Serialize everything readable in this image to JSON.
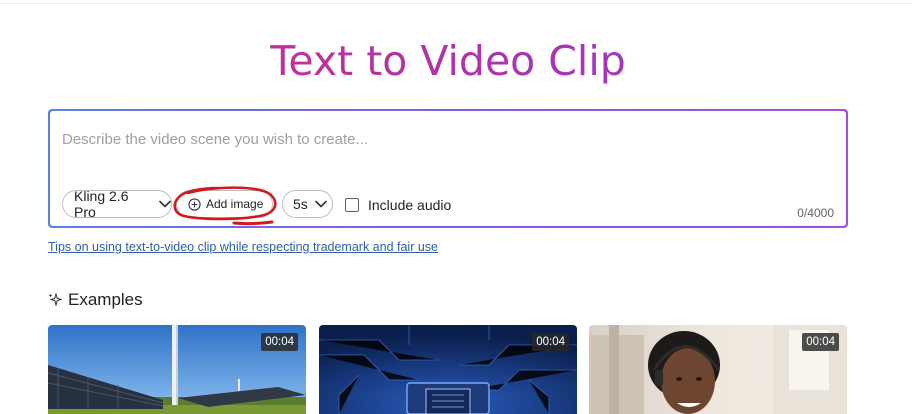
{
  "page": {
    "title": "Text to Video Clip"
  },
  "prompt": {
    "placeholder": "Describe the video scene you wish to create...",
    "value": "",
    "model_label": "Kling 2.6 Pro",
    "add_image_label": "Add image",
    "duration_label": "5s",
    "include_audio_label": "Include audio",
    "include_audio_checked": false,
    "char_counter": "0/4000"
  },
  "tips_link": "Tips on using text-to-video clip while respecting trademark and fair use",
  "examples": {
    "heading": "Examples",
    "items": [
      {
        "duration": "00:04",
        "scene": "solar-farm-wind-turbine"
      },
      {
        "duration": "00:04",
        "scene": "circuit-board-chip"
      },
      {
        "duration": "00:04",
        "scene": "woman-with-headset"
      }
    ]
  },
  "colors": {
    "title_gradient": [
      "#d9327e",
      "#b132a8",
      "#8e3fe0"
    ],
    "box_border_gradient": [
      "#5b7fe6",
      "#7e5de8",
      "#a24fe0"
    ],
    "annotation": "#d3191c",
    "link": "#2f5fa8"
  }
}
